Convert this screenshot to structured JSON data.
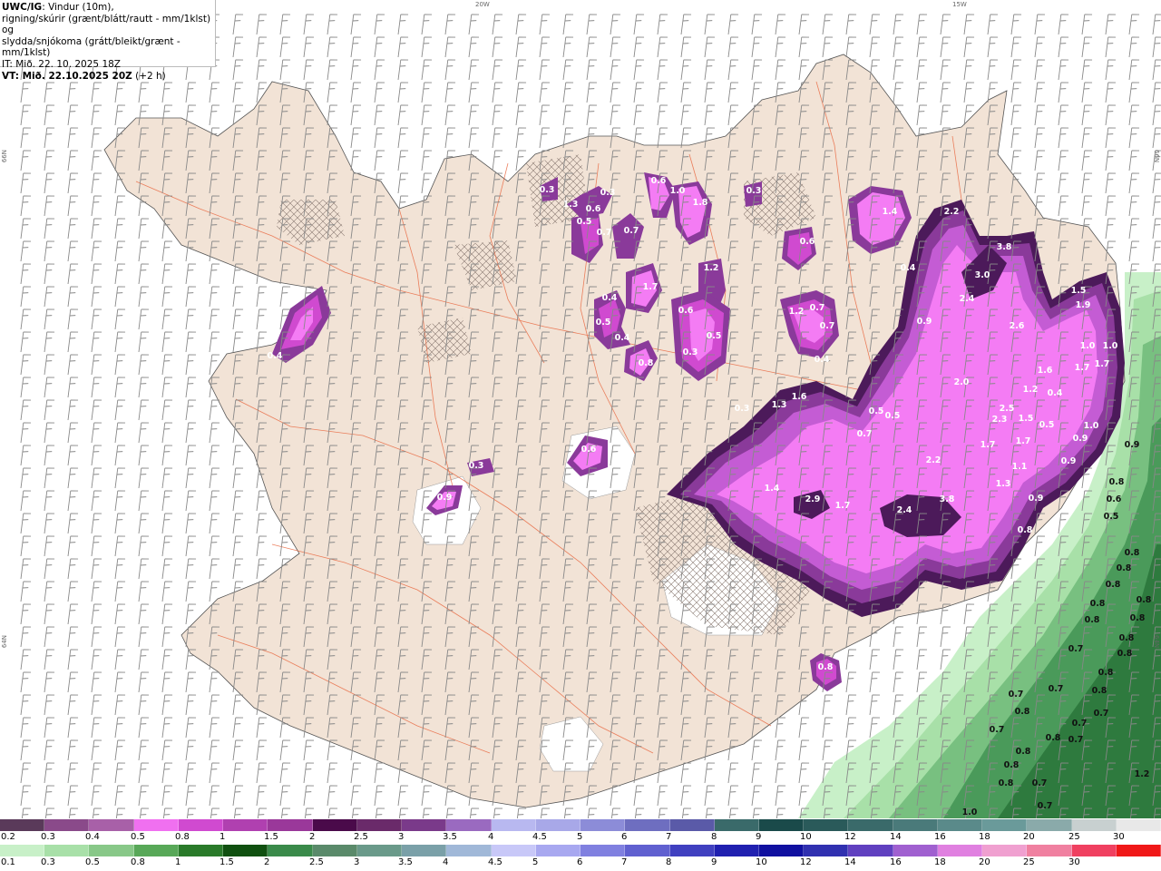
{
  "info": {
    "line1_bold": "UWC/IG",
    "line1_rest": ": Vindur (10m),",
    "line2": "rigning/skúrir (grænt/blátt/rautt - mm/1klst) og",
    "line3": "slydda/snjókoma (grátt/bleikt/grænt - mm/1klst)",
    "line4": "IT: Mið. 22. 10. 2025 18Z",
    "line5_bold": "VT: Mið. 22.10.2025 20Z",
    "line5_rest": " (+2 h)"
  },
  "coords": {
    "top_left": "20W",
    "top_right": "15W",
    "left_upper": "66N",
    "left_lower": "64N",
    "right_upper": "66N",
    "right_lower": "64N"
  },
  "colors": {
    "sea": "#ffffff",
    "land": "#f2e3d6",
    "roads": "#e8643c",
    "snow_light": "#f47cf4",
    "snow_mid": "#c45cd4",
    "snow_dark": "#8a3a9a",
    "snow_darkest": "#4c1a5a",
    "rain_light": "#c8f0c8",
    "rain_mid": "#78c080",
    "rain_dark": "#2e7a3e"
  },
  "snow_labels": [
    {
      "text": "0.3"
    },
    {
      "text": "1.3"
    },
    {
      "text": "0.4"
    },
    {
      "text": "0.3"
    },
    {
      "text": "0.6"
    },
    {
      "text": "0.5"
    },
    {
      "text": "0.7"
    },
    {
      "text": "0.7"
    },
    {
      "text": "0.6"
    },
    {
      "text": "1.0"
    },
    {
      "text": "1.8"
    },
    {
      "text": "0.3"
    },
    {
      "text": "1.4"
    },
    {
      "text": "2.2"
    },
    {
      "text": "0.6"
    },
    {
      "text": "3.8"
    },
    {
      "text": "0.4"
    },
    {
      "text": "1.7"
    },
    {
      "text": "1.2"
    },
    {
      "text": "3.0"
    },
    {
      "text": "0.4"
    },
    {
      "text": "2.4"
    },
    {
      "text": "0.5"
    },
    {
      "text": "0.6"
    },
    {
      "text": "1.2"
    },
    {
      "text": "0.7"
    },
    {
      "text": "0.9"
    },
    {
      "text": "1.5"
    },
    {
      "text": "1.9"
    },
    {
      "text": "0.4"
    },
    {
      "text": "0.5"
    },
    {
      "text": "0.7"
    },
    {
      "text": "2.6"
    },
    {
      "text": "0.3"
    },
    {
      "text": "0.4"
    },
    {
      "text": "1.0"
    },
    {
      "text": "1.0"
    },
    {
      "text": "0.8"
    },
    {
      "text": "1.6"
    },
    {
      "text": "1.7"
    },
    {
      "text": "1.7"
    },
    {
      "text": "1.6"
    },
    {
      "text": "2.0"
    },
    {
      "text": "1.2"
    },
    {
      "text": "0.3"
    },
    {
      "text": "1.3"
    },
    {
      "text": "0.5"
    },
    {
      "text": "0.5"
    },
    {
      "text": "2.5"
    },
    {
      "text": "2.3"
    },
    {
      "text": "1.5"
    },
    {
      "text": "0.5"
    },
    {
      "text": "0.7"
    },
    {
      "text": "1.0"
    },
    {
      "text": "0.6"
    },
    {
      "text": "1.7"
    },
    {
      "text": "1.7"
    },
    {
      "text": "0.9"
    },
    {
      "text": "0.3"
    },
    {
      "text": "2.2"
    },
    {
      "text": "1.1"
    },
    {
      "text": "0.9"
    },
    {
      "text": "1.4"
    },
    {
      "text": "2.9"
    },
    {
      "text": "1.3"
    },
    {
      "text": "0.9"
    },
    {
      "text": "1.7"
    },
    {
      "text": "2.4"
    },
    {
      "text": "3.8"
    },
    {
      "text": "0.9"
    },
    {
      "text": "0.8"
    },
    {
      "text": "0.8"
    },
    {
      "text": "0.4"
    }
  ],
  "rain_labels": [
    {
      "text": "0.9"
    },
    {
      "text": "0.8"
    },
    {
      "text": "0.6"
    },
    {
      "text": "0.5"
    },
    {
      "text": "0.8"
    },
    {
      "text": "0.8"
    },
    {
      "text": "0.8"
    },
    {
      "text": "0.8"
    },
    {
      "text": "0.8"
    },
    {
      "text": "0.8"
    },
    {
      "text": "0.8"
    },
    {
      "text": "0.8"
    },
    {
      "text": "0.8"
    },
    {
      "text": "0.7"
    },
    {
      "text": "0.8"
    },
    {
      "text": "0.7"
    },
    {
      "text": "0.8"
    },
    {
      "text": "0.7"
    },
    {
      "text": "0.7"
    },
    {
      "text": "0.8"
    },
    {
      "text": "0.8"
    },
    {
      "text": "0.7"
    },
    {
      "text": "0.7"
    },
    {
      "text": "0.8"
    },
    {
      "text": "0.7"
    },
    {
      "text": "0.8"
    },
    {
      "text": "0.8"
    },
    {
      "text": "0.7"
    },
    {
      "text": "0.7"
    },
    {
      "text": "1.0"
    },
    {
      "text": "1.2"
    }
  ],
  "snow_legend": {
    "colors": [
      "#5a3a5a",
      "#8a4a8a",
      "#a860a8",
      "#f070f0",
      "#d04ad0",
      "#b040b0",
      "#9a389a",
      "#4a0a4a",
      "#6a2a6a",
      "#7a3a8a",
      "#9a6ac0",
      "#b8b8f0",
      "#a8a8e8",
      "#8c8cd8",
      "#6e6ec0",
      "#5a5aa8",
      "#3a6a6a",
      "#1a4a4a",
      "#2a5a5a",
      "#3a6a6a",
      "#4a7a7a",
      "#5a8a8a",
      "#6a9a9a",
      "#8aaaaa",
      "#c8d0d0",
      "#e8e8e8"
    ],
    "ticks": [
      "0.2",
      "0.3",
      "0.4",
      "0.5",
      "0.8",
      "1",
      "1.5",
      "2",
      "2.5",
      "3",
      "3.5",
      "4",
      "4.5",
      "5",
      "6",
      "7",
      "8",
      "9",
      "10",
      "12",
      "14",
      "16",
      "18",
      "20",
      "25",
      "30"
    ]
  },
  "rain_legend": {
    "colors": [
      "#c8f0c8",
      "#a8e0a8",
      "#88c888",
      "#58a858",
      "#2a7a2a",
      "#105010",
      "#3a8a4a",
      "#5a8a6a",
      "#6a9a8a",
      "#7aa0a8",
      "#a0b8d8",
      "#c8c8f8",
      "#a8a8f0",
      "#8080e0",
      "#6060d0",
      "#4040c0",
      "#2020b0",
      "#1010a0",
      "#3030b0",
      "#6040c0",
      "#a060d0",
      "#e080e0",
      "#f0a0d0",
      "#f080a0",
      "#f04060",
      "#f01818"
    ],
    "ticks": [
      "0.1",
      "0.3",
      "0.5",
      "0.8",
      "1",
      "1.5",
      "2",
      "2.5",
      "3",
      "3.5",
      "4",
      "4.5",
      "5",
      "6",
      "7",
      "8",
      "9",
      "10",
      "12",
      "14",
      "16",
      "18",
      "20",
      "25",
      "30"
    ]
  }
}
